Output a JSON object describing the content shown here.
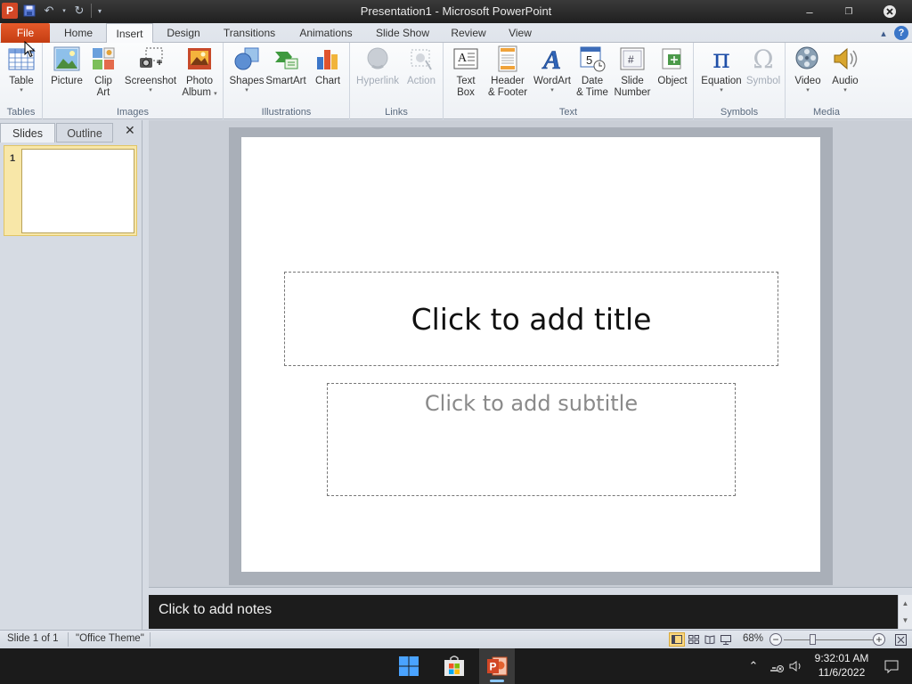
{
  "window": {
    "title": "Presentation1  -  Microsoft PowerPoint",
    "app_icon_letter": "P",
    "minimize_glyph": "–",
    "maximize_glyph": "❐",
    "close_glyph": "✖"
  },
  "quick_access": {
    "save_icon": "save-icon",
    "undo_icon": "undo-icon",
    "redo_icon": "redo-icon",
    "customize_icon": "customize-qat-icon"
  },
  "tabs": {
    "file": "File",
    "home": "Home",
    "insert": "Insert",
    "design": "Design",
    "transitions": "Transitions",
    "animations": "Animations",
    "slideshow": "Slide Show",
    "review": "Review",
    "view": "View",
    "active": "Insert"
  },
  "ribbon": {
    "groups": {
      "tables": "Tables",
      "images": "Images",
      "illustrations": "Illustrations",
      "links": "Links",
      "text": "Text",
      "symbols": "Symbols",
      "media": "Media"
    },
    "buttons": {
      "table": "Table",
      "picture": "Picture",
      "clipart_1": "Clip",
      "clipart_2": "Art",
      "screenshot": "Screenshot",
      "photoalbum_1": "Photo",
      "photoalbum_2": "Album",
      "shapes": "Shapes",
      "smartart": "SmartArt",
      "chart": "Chart",
      "hyperlink": "Hyperlink",
      "action": "Action",
      "textbox_1": "Text",
      "textbox_2": "Box",
      "headerfooter_1": "Header",
      "headerfooter_2": "& Footer",
      "wordart": "WordArt",
      "datetime_1": "Date",
      "datetime_2": "& Time",
      "slidenumber_1": "Slide",
      "slidenumber_2": "Number",
      "object": "Object",
      "equation": "Equation",
      "symbol": "Symbol",
      "video": "Video",
      "audio": "Audio"
    }
  },
  "left_panel": {
    "tab_slides": "Slides",
    "tab_outline": "Outline",
    "close_glyph": "✕",
    "slide_number": "1"
  },
  "slide": {
    "title_placeholder": "Click to add title",
    "subtitle_placeholder": "Click to add subtitle"
  },
  "notes": {
    "placeholder": "Click to add notes"
  },
  "status_bar": {
    "slide_info": "Slide 1 of 1",
    "theme": "\"Office Theme\"",
    "zoom": "68%",
    "zoom_value_percent": 68
  },
  "taskbar": {
    "time": "9:32:01 AM",
    "date": "11/6/2022"
  },
  "colors": {
    "file_tab": "#d24726",
    "ribbon_bg": "#f5f7fa",
    "notes_bg": "#1c1c1c",
    "taskbar_bg": "#1b1b1b"
  }
}
